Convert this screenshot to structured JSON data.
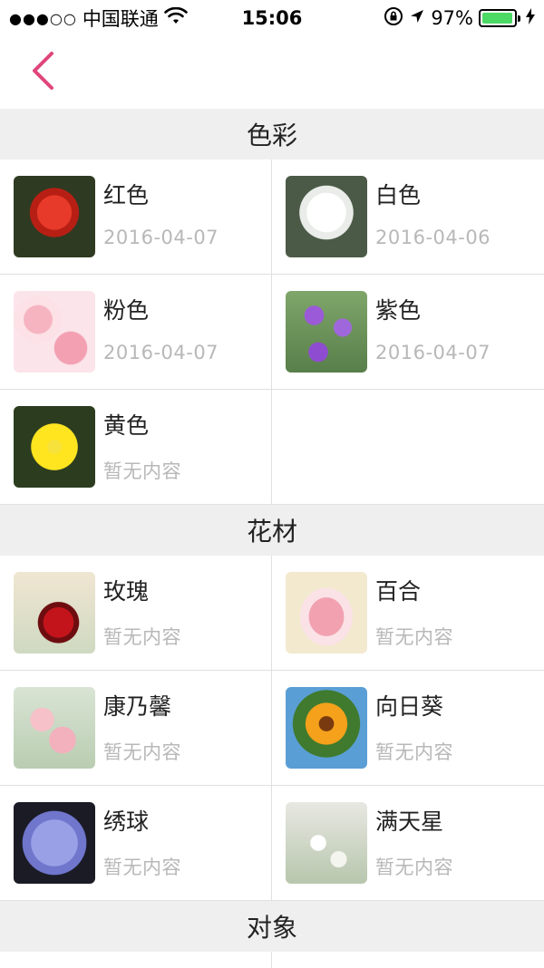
{
  "status_bar": {
    "carrier": "中国联通",
    "time": "15:06",
    "battery_percent": "97%",
    "battery_level": 0.97,
    "icons": [
      "signal-dots-icon",
      "wifi-icon",
      "orientation-lock-icon",
      "location-arrow-icon",
      "battery-icon",
      "charging-bolt-icon"
    ]
  },
  "nav": {
    "back_icon": "chevron-left-icon",
    "accent_color": "#e0457b"
  },
  "sections": [
    {
      "title": "色彩",
      "items": [
        {
          "title": "红色",
          "subtitle": "2016-04-07",
          "thumb": "red-gerbera"
        },
        {
          "title": "白色",
          "subtitle": "2016-04-06",
          "thumb": "white-rose"
        },
        {
          "title": "粉色",
          "subtitle": "2016-04-07",
          "thumb": "pink-roses"
        },
        {
          "title": "紫色",
          "subtitle": "2016-04-07",
          "thumb": "purple-verbena"
        },
        {
          "title": "黄色",
          "subtitle": "暂无内容",
          "thumb": "yellow-daisy"
        }
      ]
    },
    {
      "title": "花材",
      "items": [
        {
          "title": "玫瑰",
          "subtitle": "暂无内容",
          "thumb": "red-rose"
        },
        {
          "title": "百合",
          "subtitle": "暂无内容",
          "thumb": "pink-lily"
        },
        {
          "title": "康乃馨",
          "subtitle": "暂无内容",
          "thumb": "carnations"
        },
        {
          "title": "向日葵",
          "subtitle": "暂无内容",
          "thumb": "sunflower"
        },
        {
          "title": "绣球",
          "subtitle": "暂无内容",
          "thumb": "hydrangea"
        },
        {
          "title": "满天星",
          "subtitle": "暂无内容",
          "thumb": "babys-breath"
        }
      ]
    },
    {
      "title": "对象",
      "items": []
    }
  ]
}
